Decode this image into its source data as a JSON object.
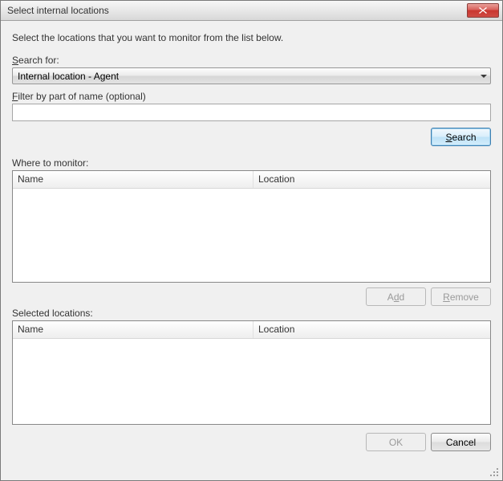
{
  "title": "Select internal locations",
  "instruction": "Select the locations that you want to monitor from the list below.",
  "search": {
    "label": "Search for:",
    "selected": "Internal location - Agent"
  },
  "filter": {
    "label": "Filter by part of name (optional)",
    "value": ""
  },
  "buttons": {
    "search": "Search",
    "add": "Add",
    "remove": "Remove",
    "ok": "OK",
    "cancel": "Cancel"
  },
  "whereToMonitor": {
    "label": "Where to monitor:",
    "columns": {
      "name": "Name",
      "location": "Location"
    },
    "rows": []
  },
  "selectedLocations": {
    "label": "Selected locations:",
    "columns": {
      "name": "Name",
      "location": "Location"
    },
    "rows": []
  }
}
